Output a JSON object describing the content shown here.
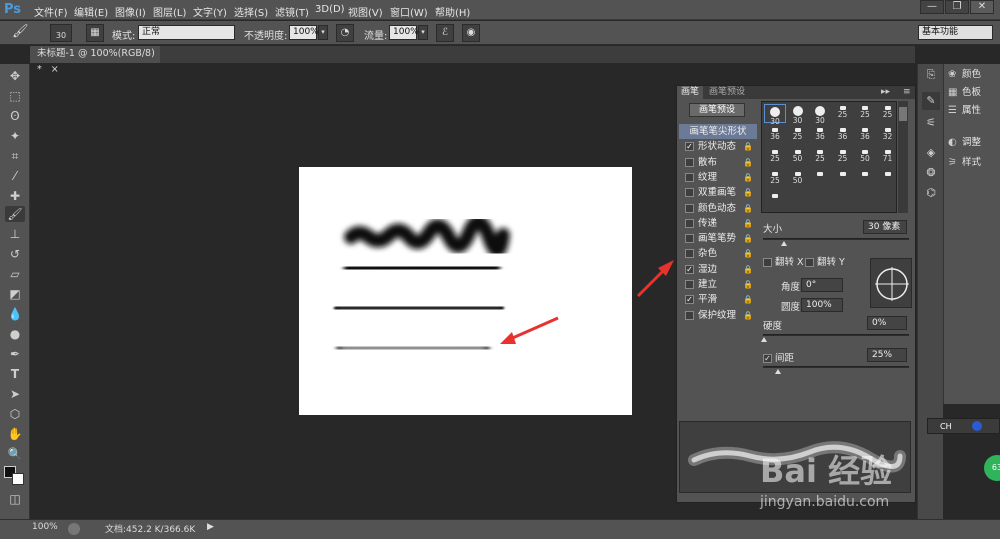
{
  "app": {
    "logo": "Ps"
  },
  "menu": [
    "文件(F)",
    "编辑(E)",
    "图像(I)",
    "图层(L)",
    "文字(Y)",
    "选择(S)",
    "滤镜(T)",
    "3D(D)",
    "视图(V)",
    "窗口(W)",
    "帮助(H)"
  ],
  "window_controls": {
    "minimize": "—",
    "restore": "❐",
    "close": "✕"
  },
  "options": {
    "brush_size": "30",
    "mode_label": "模式:",
    "mode_value": "正常",
    "opacity_label": "不透明度:",
    "opacity_value": "100%",
    "flow_label": "流量:",
    "flow_value": "100%",
    "workspace": "基本功能"
  },
  "document_tab": {
    "title": "未标题-1 @ 100%(RGB/8) *",
    "close": "×"
  },
  "status": {
    "zoom": "100%",
    "doc_info": "文档:452.2 K/366.6K"
  },
  "brush_panel": {
    "tab_active": "画笔",
    "tab_inactive": "画笔预设",
    "preset_button": "画笔预设",
    "list": [
      {
        "label": "画笔笔尖形状",
        "checked": null,
        "lock": false,
        "selected": true
      },
      {
        "label": "形状动态",
        "checked": true,
        "lock": true
      },
      {
        "label": "散布",
        "checked": false,
        "lock": true
      },
      {
        "label": "纹理",
        "checked": false,
        "lock": true
      },
      {
        "label": "双重画笔",
        "checked": false,
        "lock": true
      },
      {
        "label": "颜色动态",
        "checked": false,
        "lock": true
      },
      {
        "label": "传递",
        "checked": false,
        "lock": true
      },
      {
        "label": "画笔笔势",
        "checked": false,
        "lock": true
      },
      {
        "label": "杂色",
        "checked": false,
        "lock": true
      },
      {
        "label": "湿边",
        "checked": true,
        "lock": true
      },
      {
        "label": "建立",
        "checked": false,
        "lock": true
      },
      {
        "label": "平滑",
        "checked": true,
        "lock": true
      },
      {
        "label": "保护纹理",
        "checked": false,
        "lock": true
      }
    ],
    "tips": [
      "30",
      "30",
      "30",
      "25",
      "25",
      "25",
      "36",
      "25",
      "36",
      "36",
      "36",
      "32",
      "25",
      "50",
      "25",
      "25",
      "50",
      "71",
      "25",
      "50",
      "",
      "",
      "",
      "",
      ""
    ],
    "size_label": "大小",
    "size_value": "30 像素",
    "flip_x": "翻转 X",
    "flip_y": "翻转 Y",
    "angle_label": "角度:",
    "angle_value": "0°",
    "roundness_label": "圆度:",
    "roundness_value": "100%",
    "hardness_label": "硬度",
    "hardness_value": "0%",
    "spacing_label": "间距",
    "spacing_value": "25%",
    "spacing_checked": true
  },
  "right_panels": [
    {
      "icon": "palette-icon",
      "label": "颜色"
    },
    {
      "icon": "swatches-icon",
      "label": "色板"
    },
    {
      "icon": "properties-icon",
      "label": "属性"
    },
    {
      "icon": "adjustments-icon",
      "label": "调整"
    },
    {
      "icon": "styles-icon",
      "label": "样式"
    }
  ],
  "ime": {
    "label": "CH"
  },
  "watermark": {
    "brand": "Bai 经验",
    "url": "jingyan.baidu.com"
  },
  "badge": "63"
}
